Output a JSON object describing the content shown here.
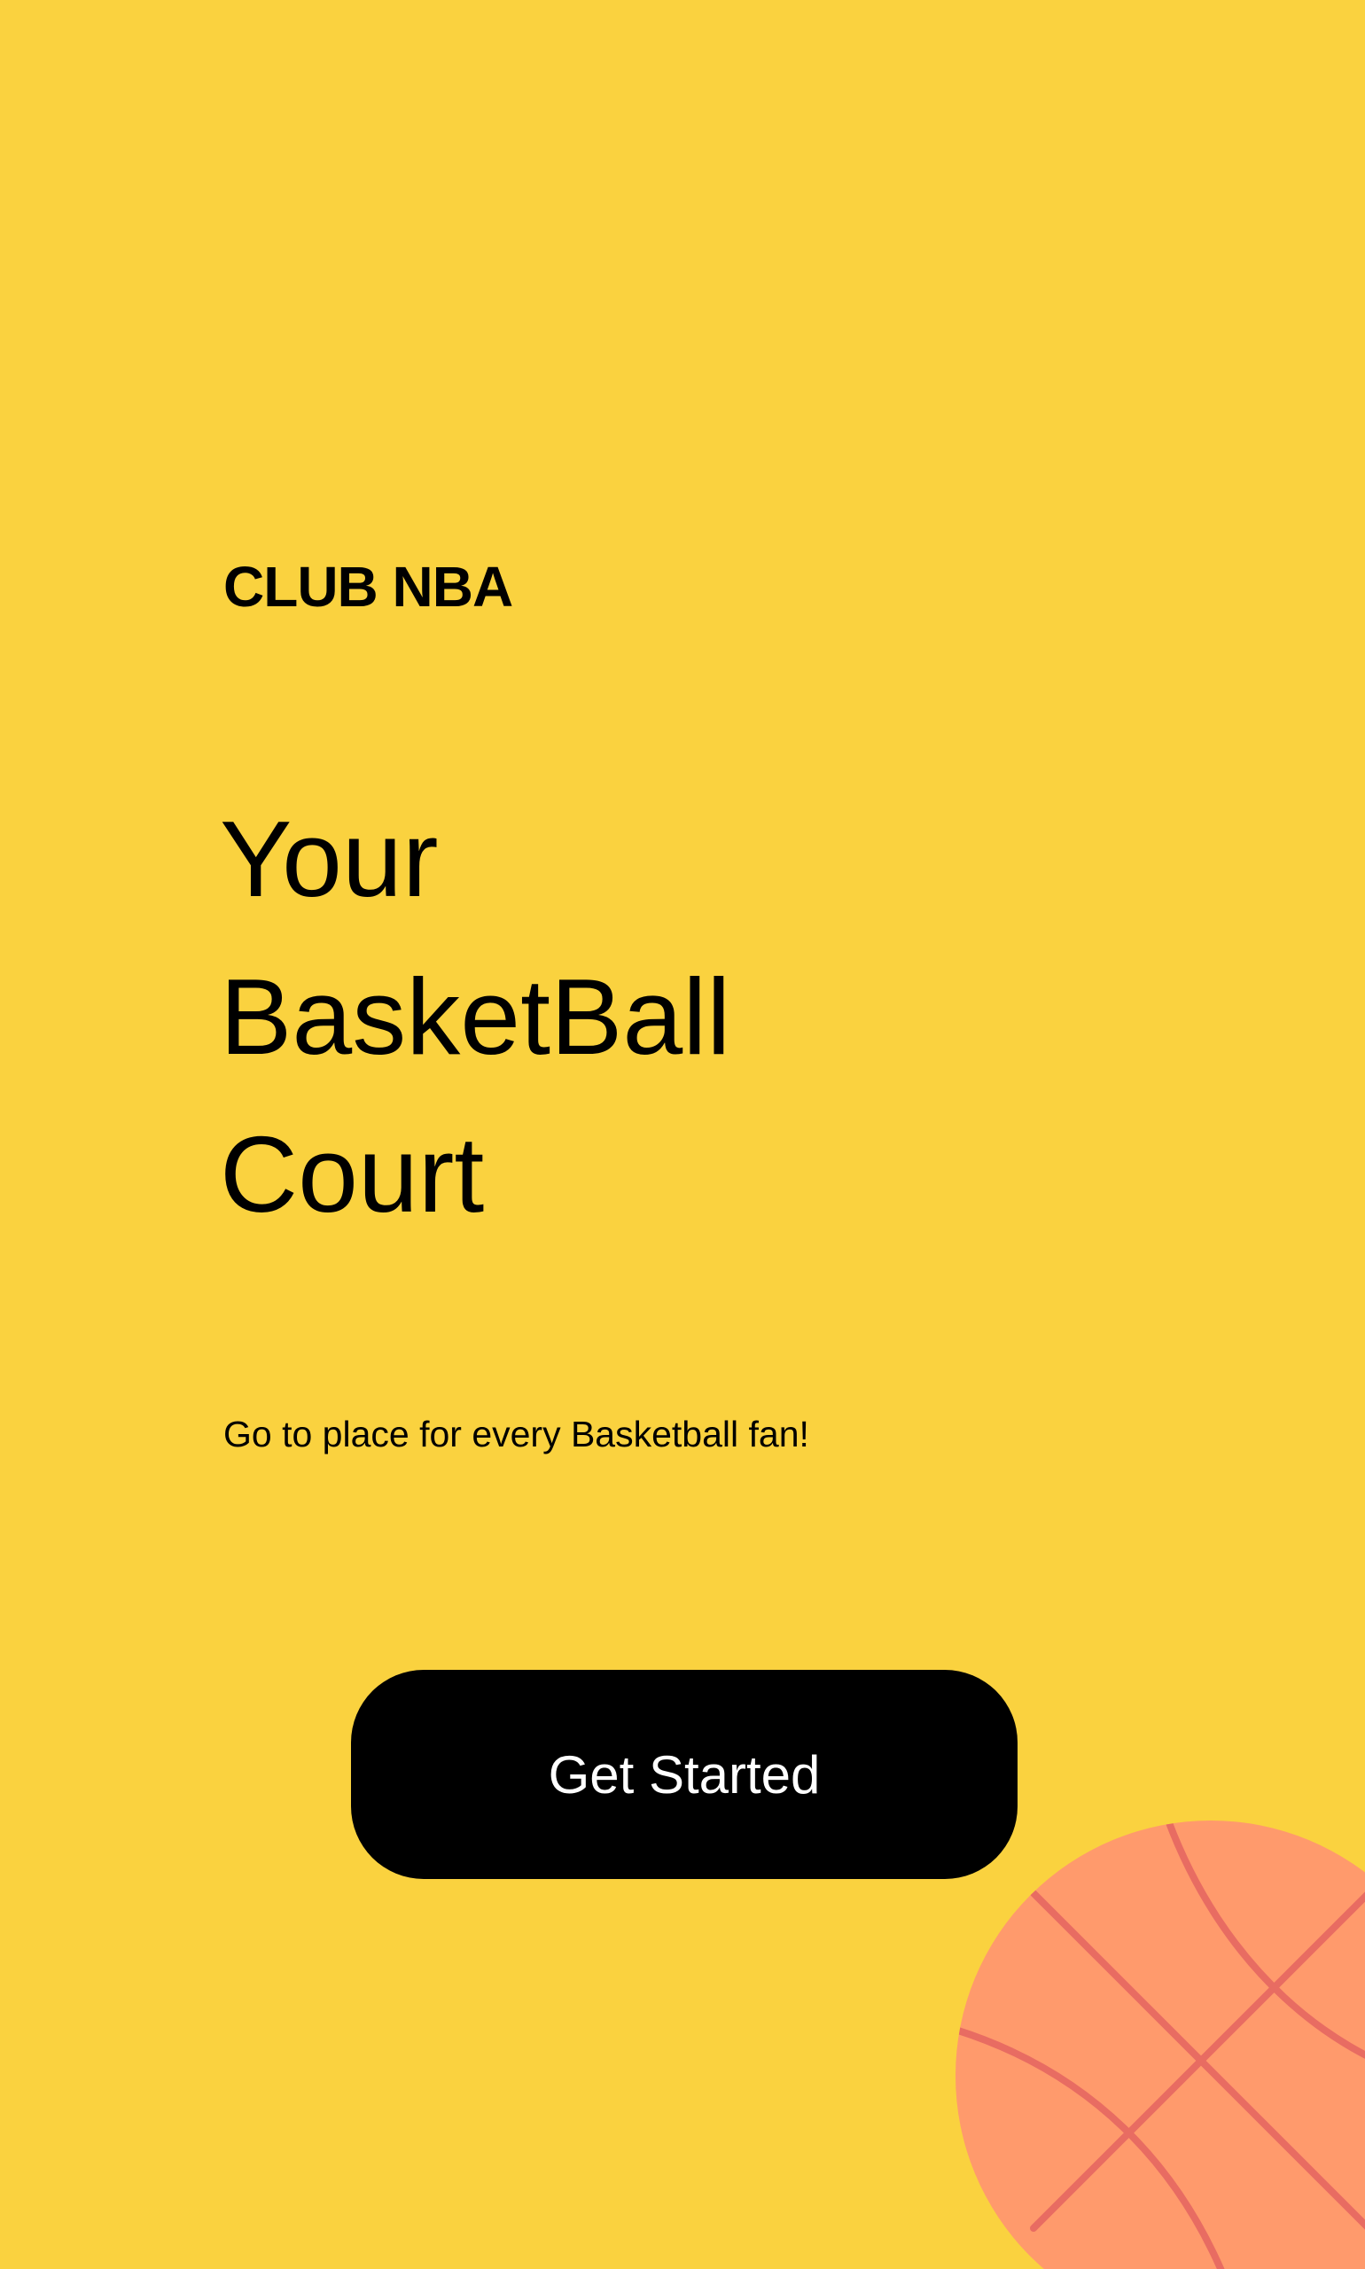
{
  "app": {
    "brand": "CLUB NBA"
  },
  "hero": {
    "headline_lines": [
      "Your",
      "BasketBall",
      "Court"
    ],
    "tagline": "Go to place for every Basketball fan!"
  },
  "actions": {
    "get_started_label": "Get Started"
  },
  "decor": {
    "ball_icon": "basketball-icon"
  },
  "colors": {
    "background": "#FAD23F",
    "button": "#000000",
    "button_text": "#FFFFFF",
    "ball_fill": "#FF9A6C",
    "ball_lines": "#E86C62"
  }
}
